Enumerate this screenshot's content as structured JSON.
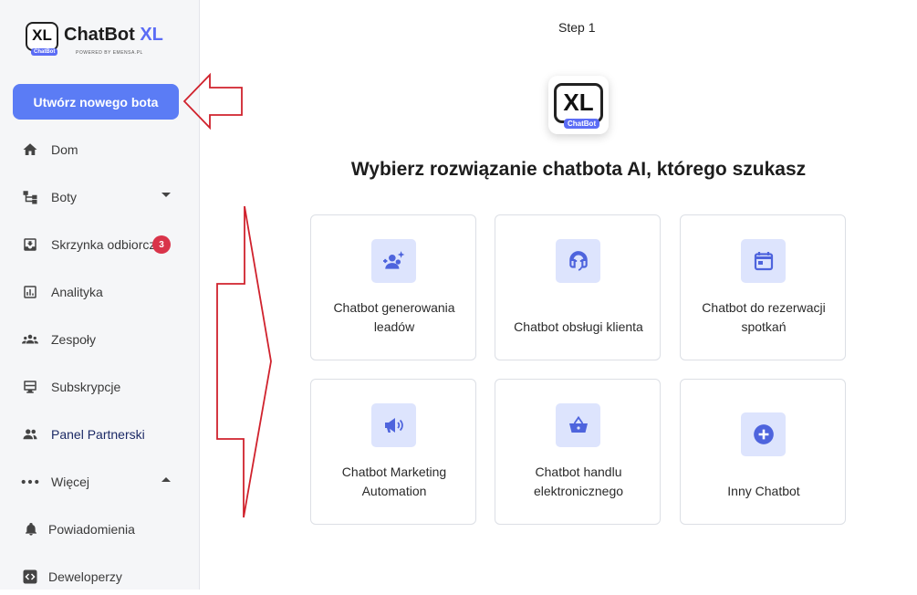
{
  "brand": {
    "badge": "XL",
    "badge_sub": "ChatBot",
    "name_main": "ChatBot",
    "name_accent": "XL",
    "powered": "POWERED BY EMENSA.PL"
  },
  "sidebar": {
    "create_button": "Utwórz nowego bota",
    "items": [
      {
        "label": "Dom",
        "icon": "home-icon"
      },
      {
        "label": "Boty",
        "icon": "bots-tree-icon"
      },
      {
        "label": "Skrzynka odbiorcza",
        "icon": "inbox-icon",
        "badge": "3"
      },
      {
        "label": "Analityka",
        "icon": "analytics-icon"
      },
      {
        "label": "Zespoły",
        "icon": "teams-icon"
      },
      {
        "label": "Subskrypcje",
        "icon": "subscriptions-icon"
      },
      {
        "label": "Panel Partnerski",
        "icon": "partners-icon"
      },
      {
        "label": "Więcej",
        "icon": "more-dots-icon"
      },
      {
        "label": "Powiadomienia",
        "icon": "bell-icon"
      },
      {
        "label": "Deweloperzy",
        "icon": "code-icon"
      }
    ]
  },
  "main": {
    "step": "Step 1",
    "hero_badge": "XL",
    "hero_badge_sub": "ChatBot",
    "heading": "Wybierz rozwiązanie chatbota AI, którego szukasz",
    "cards": [
      {
        "line1": "Chatbot generowania",
        "line2": "leadów",
        "icon": "add-user-sparkle-icon"
      },
      {
        "line1": "Chatbot obsługi klienta",
        "line2": "",
        "icon": "headset-icon"
      },
      {
        "line1": "Chatbot do rezerwacji",
        "line2": "spotkań",
        "icon": "calendar-icon"
      },
      {
        "line1": "Chatbot Marketing",
        "line2": "Automation",
        "icon": "megaphone-icon"
      },
      {
        "line1": "Chatbot handlu",
        "line2": "elektronicznego",
        "icon": "basket-icon"
      },
      {
        "line1": "Inny Chatbot",
        "line2": "",
        "icon": "plus-circle-icon"
      }
    ]
  },
  "colors": {
    "accent": "#5b7cf5",
    "icon_bg": "#dde4fd",
    "icon_fg": "#4e64dd",
    "badge": "#d9344a",
    "annotation": "#d0222d"
  }
}
